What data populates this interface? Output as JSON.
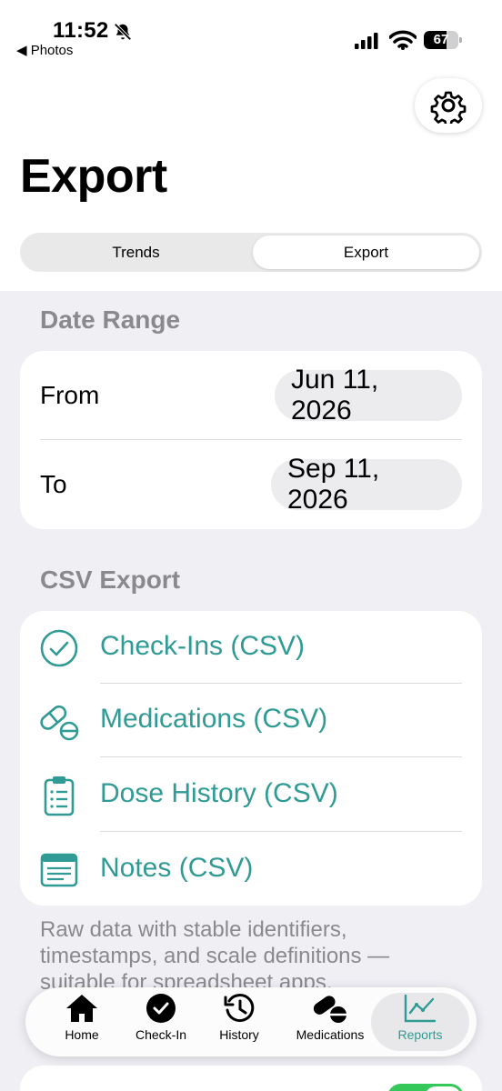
{
  "status_bar": {
    "time": "11:52",
    "back_label": "◀ Photos",
    "battery": "67",
    "battery_level": 0.67
  },
  "header": {
    "title": "Export",
    "settings_icon": "gear-icon"
  },
  "segmented": {
    "left": "Trends",
    "right": "Export",
    "selected": "Export"
  },
  "date_range": {
    "label": "Date Range",
    "from_label": "From",
    "from_value": "Jun 11, 2026",
    "to_label": "To",
    "to_value": "Sep 11, 2026"
  },
  "csv_export": {
    "label": "CSV Export",
    "items": [
      {
        "label": "Check-Ins (CSV)",
        "icon": "checkmark-circle-icon"
      },
      {
        "label": "Medications (CSV)",
        "icon": "pills-icon"
      },
      {
        "label": "Dose History (CSV)",
        "icon": "clipboard-list-icon"
      },
      {
        "label": "Notes (CSV)",
        "icon": "notes-icon"
      }
    ],
    "accent": "#2f9b94",
    "footnote": "Raw data with stable identifiers, timestamps, and scale definitions — suitable for spreadsheet apps."
  },
  "tabbar": {
    "items": [
      {
        "label": "Home",
        "icon": "house-icon"
      },
      {
        "label": "Check-In",
        "icon": "checkmark-circle-fill-icon"
      },
      {
        "label": "History",
        "icon": "clock-history-icon"
      },
      {
        "label": "Medications",
        "icon": "pills-icon"
      },
      {
        "label": "Reports",
        "icon": "chart-line-icon"
      }
    ],
    "active": "Reports"
  },
  "toggle": {
    "on": true,
    "color": "#34c759"
  }
}
